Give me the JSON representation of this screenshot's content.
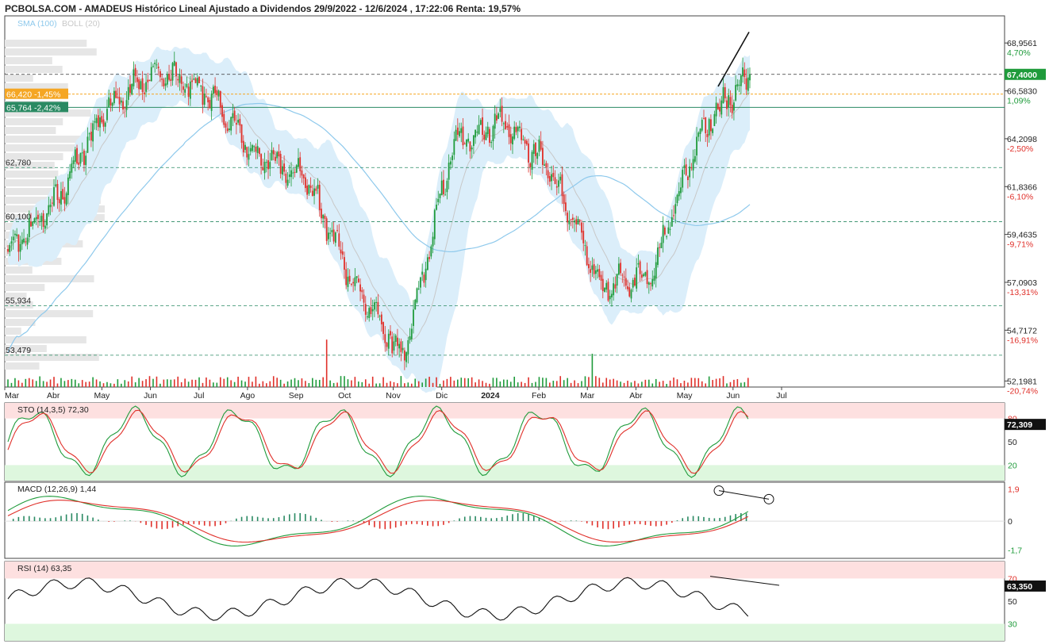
{
  "header": {
    "title": "PCBOLSA.COM - AMADEUS Histórico Lineal Ajustado a Dividendos 29/9/2022 - 12/6/2024 , 17:22:06 Renta: 19,57%"
  },
  "main": {
    "legend": [
      {
        "text": "SMA (100)",
        "color": "#8ec9ec"
      },
      {
        "text": "BOLL (20)",
        "color": "#c8c8c8"
      }
    ],
    "y_ticks": [
      {
        "value": 68.9561,
        "label": "68,9561",
        "pct": "4,70%",
        "pct_color": "#1f9b3b"
      },
      {
        "value": 66.583,
        "label": "66,5830",
        "pct": "1,09%",
        "pct_color": "#1f9b3b"
      },
      {
        "value": 64.2098,
        "label": "64,2098",
        "pct": "-2,50%",
        "pct_color": "#e0302a"
      },
      {
        "value": 61.8366,
        "label": "61,8366",
        "pct": "-6,10%",
        "pct_color": "#e0302a"
      },
      {
        "value": 59.4635,
        "label": "59,4635",
        "pct": "-9,71%",
        "pct_color": "#e0302a"
      },
      {
        "value": 57.0903,
        "label": "57,0903",
        "pct": "-13,31%",
        "pct_color": "#e0302a"
      },
      {
        "value": 54.7172,
        "label": "54,7172",
        "pct": "-16,91%",
        "pct_color": "#e0302a"
      },
      {
        "value": 52.1981,
        "label": "52,1981",
        "pct": "-20,74%",
        "pct_color": "#e0302a"
      }
    ],
    "last_price": {
      "value": 67.4,
      "label": "67,4000",
      "color": "#1f9b3b"
    },
    "markers": [
      {
        "value": 66.42,
        "label": "66,420  -1,45%",
        "color": "#f5a623",
        "style": "dashed-orange"
      },
      {
        "value": 65.764,
        "label": "65,764  -2,42%",
        "color": "#2a8a63",
        "style": "solid-teal"
      }
    ],
    "support_levels": [
      {
        "value": 62.78,
        "label": "62,780"
      },
      {
        "value": 60.1,
        "label": "60,100"
      },
      {
        "value": 55.934,
        "label": "55,934"
      },
      {
        "value": 53.479,
        "label": "53,479"
      }
    ],
    "x_labels": [
      "Mar",
      "Abr",
      "May",
      "Jun",
      "Jul",
      "Ago",
      "Sep",
      "Oct",
      "Nov",
      "Dic",
      "2024",
      "Feb",
      "Mar",
      "Abr",
      "May",
      "Jun",
      "Jul"
    ]
  },
  "sto": {
    "label": "STO (14,3,5)",
    "value_text": "72,30",
    "ticks": [
      "80",
      "50",
      "20"
    ],
    "last_label": "72,309"
  },
  "macd": {
    "label": "MACD (12,26,9)",
    "value_text": "1,44",
    "ticks": [
      "1,9",
      "0",
      "-1,7"
    ]
  },
  "rsi": {
    "label": "RSI (14)",
    "value_text": "63,35",
    "ticks": [
      "70",
      "50",
      "30"
    ],
    "last_label": "63,350"
  },
  "chart_data": {
    "type": "candlestick",
    "title": "PCBOLSA.COM - AMADEUS Histórico Lineal Ajustado a Dividendos 29/9/2022 - 12/6/2024 , 17:22:06 Renta: 19,57%",
    "xlabel": "",
    "ylabel": "",
    "ylim": [
      51.9,
      70.3
    ],
    "y_ticks": [
      68.9561,
      66.583,
      64.2098,
      61.8366,
      59.4635,
      57.0903,
      54.7172,
      52.1981
    ],
    "close_approx": {
      "months": [
        "Mar",
        "Abr",
        "May",
        "Jun",
        "Jul",
        "Ago",
        "Sep",
        "Oct",
        "Nov",
        "Dic",
        "2024",
        "Feb",
        "Mar",
        "Abr",
        "May",
        "Jun"
      ],
      "values": [
        58.5,
        61.2,
        65.8,
        67.5,
        66.6,
        63.4,
        62.4,
        57.0,
        53.3,
        63.9,
        65.1,
        62.5,
        56.8,
        57.5,
        64.6,
        67.4
      ]
    },
    "last_close": 67.4,
    "levels": [
      62.78,
      60.1,
      55.934,
      53.479
    ],
    "markers": [
      66.42,
      65.764
    ],
    "indicators": {
      "STO (14,3,5)": {
        "last": 72.309,
        "levels": [
          80,
          50,
          20
        ]
      },
      "MACD (12,26,9)": {
        "last": 1.44,
        "ticks": [
          1.9,
          0,
          -1.7
        ]
      },
      "RSI (14)": {
        "last": 63.35,
        "levels": [
          70,
          50,
          30
        ]
      }
    }
  }
}
